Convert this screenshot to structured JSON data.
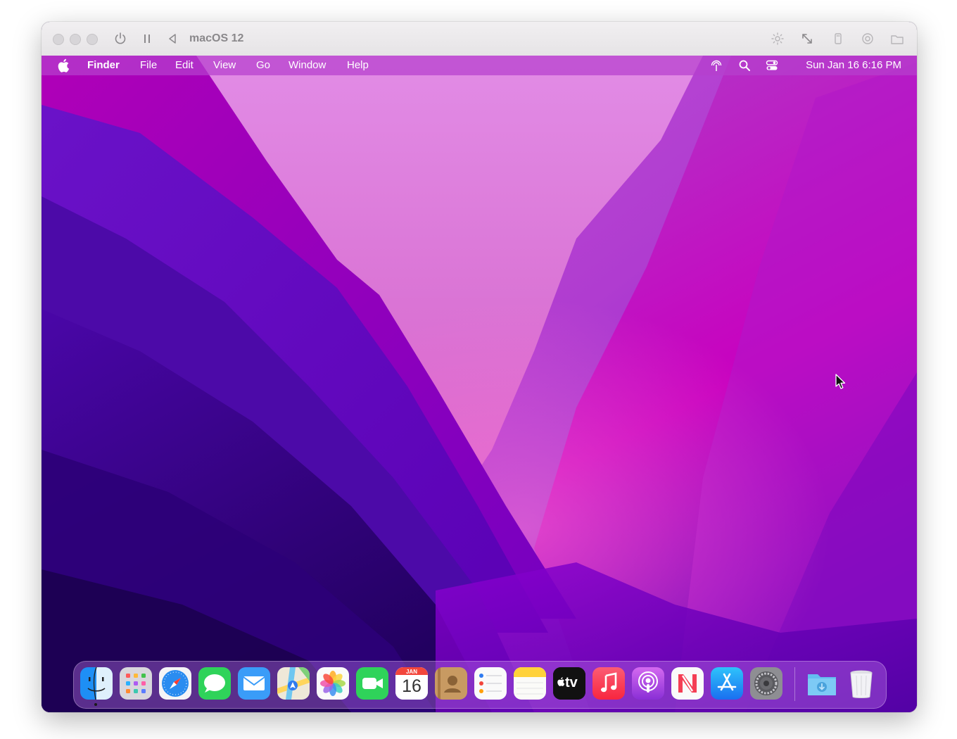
{
  "vm": {
    "title": "macOS 12"
  },
  "menubar": {
    "app_name": "Finder",
    "items": [
      "File",
      "Edit",
      "View",
      "Go",
      "Window",
      "Help"
    ],
    "clock": "Sun Jan 16  6:16 PM"
  },
  "dock": {
    "apps": [
      {
        "name": "Finder",
        "icon": "finder-icon",
        "running": true
      },
      {
        "name": "Launchpad",
        "icon": "launchpad-icon"
      },
      {
        "name": "Safari",
        "icon": "safari-icon"
      },
      {
        "name": "Messages",
        "icon": "messages-icon"
      },
      {
        "name": "Mail",
        "icon": "mail-icon"
      },
      {
        "name": "Maps",
        "icon": "maps-icon"
      },
      {
        "name": "Photos",
        "icon": "photos-icon"
      },
      {
        "name": "FaceTime",
        "icon": "facetime-icon"
      },
      {
        "name": "Calendar",
        "icon": "calendar-icon"
      },
      {
        "name": "Contacts",
        "icon": "contacts-icon"
      },
      {
        "name": "Reminders",
        "icon": "reminders-icon"
      },
      {
        "name": "Notes",
        "icon": "notes-icon"
      },
      {
        "name": "TV",
        "icon": "apple-tv-icon"
      },
      {
        "name": "Music",
        "icon": "music-icon"
      },
      {
        "name": "Podcasts",
        "icon": "podcasts-icon"
      },
      {
        "name": "News",
        "icon": "news-icon"
      },
      {
        "name": "App Store",
        "icon": "app-store-icon"
      },
      {
        "name": "System Preferences",
        "icon": "system-preferences-icon"
      },
      {
        "name": "Downloads",
        "icon": "downloads-folder-icon"
      },
      {
        "name": "Trash",
        "icon": "trash-icon"
      }
    ],
    "calendar": {
      "month": "JAN",
      "day": "16"
    },
    "tv_label": "tv"
  },
  "colors": {
    "menubar": "#b640cd",
    "wallpaper_light": "#d97ae0",
    "wallpaper_magenta": "#c800c0",
    "wallpaper_deep": "#3a0098"
  }
}
